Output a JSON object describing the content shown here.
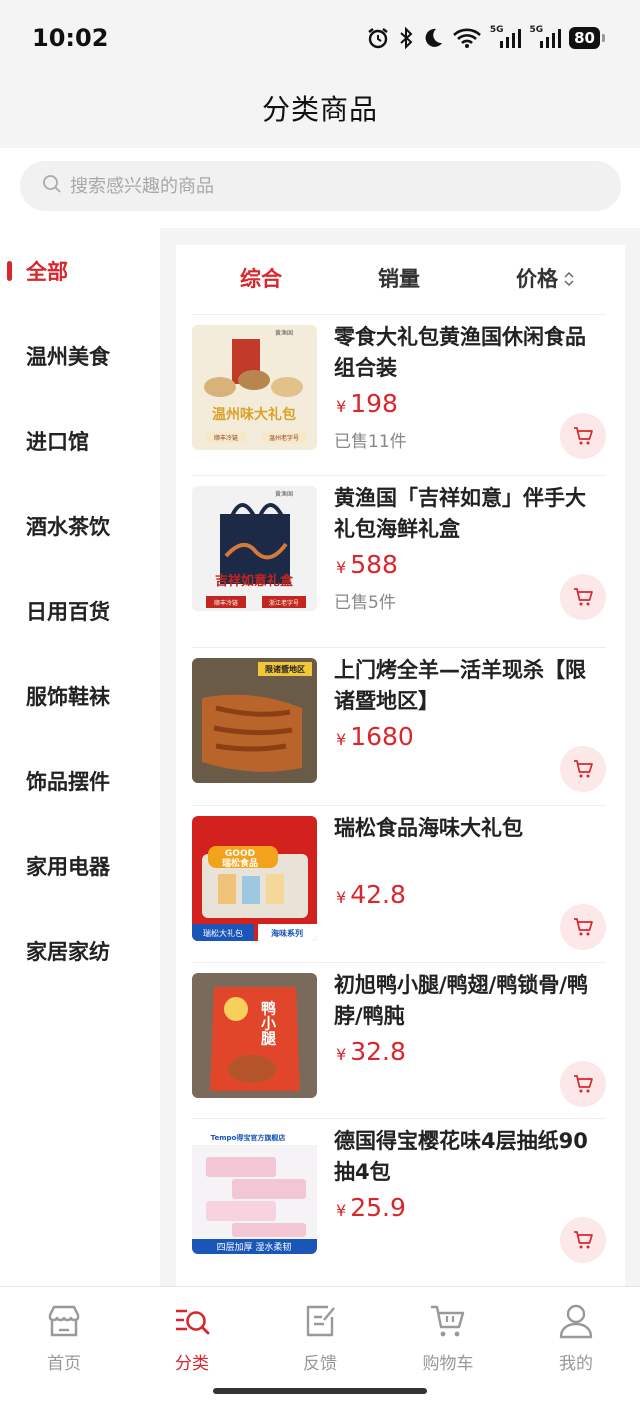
{
  "status": {
    "time": "10:02",
    "net1": "5G",
    "net2": "5G",
    "battery": "80"
  },
  "header": {
    "title": "分类商品"
  },
  "search": {
    "placeholder": "搜索感兴趣的商品"
  },
  "categories": [
    {
      "label": "全部",
      "active": true
    },
    {
      "label": "温州美食"
    },
    {
      "label": "进口馆"
    },
    {
      "label": "酒水茶饮"
    },
    {
      "label": "日用百货"
    },
    {
      "label": "服饰鞋袜"
    },
    {
      "label": "饰品摆件"
    },
    {
      "label": "家用电器"
    },
    {
      "label": "家居家纺"
    }
  ],
  "sort": {
    "comprehensive": "综合",
    "sales": "销量",
    "price": "价格"
  },
  "products": [
    {
      "name": "零食大礼包黄渔国休闲食品组合装",
      "currency": "¥",
      "price": "198",
      "sold": "已售11件",
      "img_text": "温州味大礼包",
      "img_tag1": "顺丰冷链",
      "img_tag2": "温州老字号",
      "img_brand": "黄渔国"
    },
    {
      "name": "黄渔国「吉祥如意」伴手大礼包海鲜礼盒",
      "currency": "¥",
      "price": "588",
      "sold": "已售5件",
      "img_text": "吉祥如意礼盒",
      "img_tag1": "顺丰冷链",
      "img_tag2": "浙江老字号",
      "img_brand": "黄渔国"
    },
    {
      "name": "上门烤全羊—活羊现杀【限诸暨地区】",
      "currency": "¥",
      "price": "1680",
      "sold": "",
      "img_badge": "限诸暨地区"
    },
    {
      "name": "瑞松食品海味大礼包",
      "currency": "¥",
      "price": "42.8",
      "sold": "",
      "img_good": "GOOD",
      "img_brand": "瑞松食品",
      "img_tag1": "瑞松大礼包",
      "img_tag2": "海味系列"
    },
    {
      "name": "初旭鸭小腿/鸭翅/鸭锁骨/鸭脖/鸭肫",
      "currency": "¥",
      "price": "32.8",
      "sold": "",
      "img_text": "鸭小腿"
    },
    {
      "name": "德国得宝樱花味4层抽纸90抽4包",
      "currency": "¥",
      "price": "25.9",
      "sold": "",
      "img_brand": "Tempo得宝官方旗舰店",
      "img_text": "四层加厚 湿水柔韧"
    }
  ],
  "tabbar": [
    {
      "label": "首页",
      "icon": "home-store-icon"
    },
    {
      "label": "分类",
      "icon": "category-search-icon",
      "active": true
    },
    {
      "label": "反馈",
      "icon": "feedback-edit-icon"
    },
    {
      "label": "购物车",
      "icon": "cart-icon"
    },
    {
      "label": "我的",
      "icon": "user-icon"
    }
  ],
  "colors": {
    "accent": "#d9262c",
    "cart_bg": "#fce8e8",
    "page_bg": "#f4f4f4"
  }
}
